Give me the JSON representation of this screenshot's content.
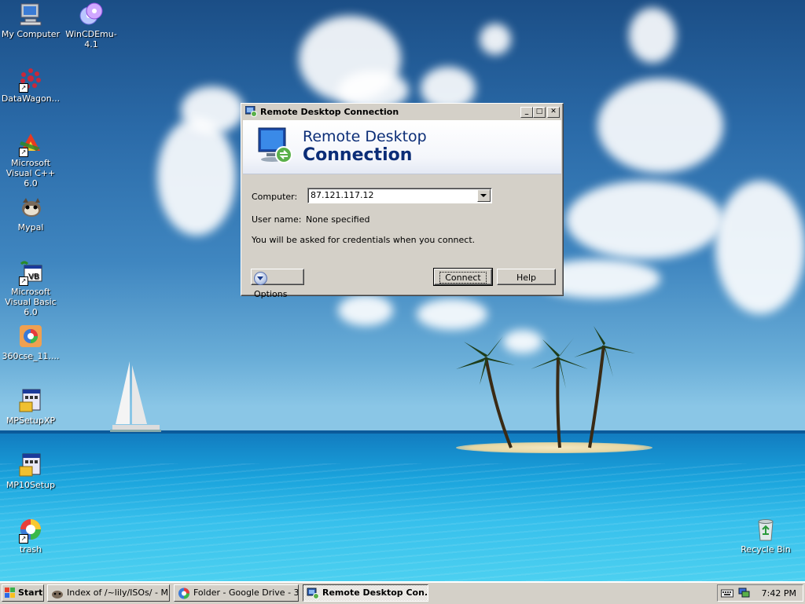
{
  "desktop": {
    "icons": [
      {
        "label": "My Computer",
        "icon": "my-computer-icon"
      },
      {
        "label": "WinCDEmu-4.1",
        "icon": "cd-emulator-icon"
      },
      {
        "label": "DataWagon...",
        "icon": "datawagon-icon"
      },
      {
        "label": "Microsoft Visual C++ 6.0",
        "icon": "visual-cpp-icon"
      },
      {
        "label": "Mypal",
        "icon": "mypal-browser-icon"
      },
      {
        "label": "Microsoft Visual Basic 6.0",
        "icon": "visual-basic-icon"
      },
      {
        "label": "360cse_11....",
        "icon": "360-browser-icon"
      },
      {
        "label": "MPSetupXP",
        "icon": "installer-icon"
      },
      {
        "label": "MP10Setup",
        "icon": "installer-icon"
      },
      {
        "label": "trash",
        "icon": "trash-shortcut-icon"
      },
      {
        "label": "Recycle Bin",
        "icon": "recycle-bin-icon"
      }
    ]
  },
  "window": {
    "title": "Remote Desktop Connection",
    "banner_line1": "Remote Desktop",
    "banner_line2": "Connection",
    "computer_label": "Computer:",
    "computer_value": "87.121.117.12",
    "username_label": "User name:",
    "username_value": "None specified",
    "info_text": "You will be asked for credentials when you connect.",
    "options_label": "Options",
    "connect_label": "Connect",
    "help_label": "Help",
    "min_glyph": "_",
    "max_glyph": "□",
    "close_glyph": "✕"
  },
  "taskbar": {
    "start_label": "Start",
    "items": [
      {
        "label": "Index of /~lily/ISOs/ - M...",
        "icon": "mypal-browser-icon",
        "active": false
      },
      {
        "label": "Folder - Google Drive - 3...",
        "icon": "360-browser-icon",
        "active": false
      },
      {
        "label": "Remote Desktop Con...",
        "icon": "remote-desktop-icon",
        "active": true
      }
    ],
    "clock": "7:42 PM"
  },
  "colors": {
    "accent_title": "#0b2d77",
    "sky": "#2a6aa8",
    "sea": "#1aa3dc"
  }
}
